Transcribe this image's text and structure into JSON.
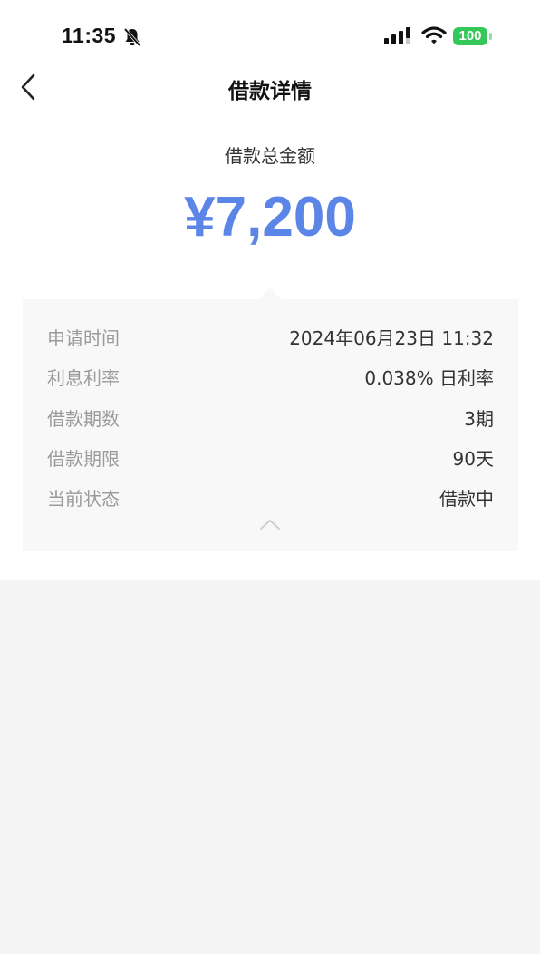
{
  "status_bar": {
    "time": "11:35",
    "battery": "100",
    "icons": [
      "bell-off-icon",
      "signal-icon",
      "wifi-icon",
      "battery-icon"
    ]
  },
  "nav": {
    "back_icon": "chevron-left-icon",
    "title": "借款详情"
  },
  "loan": {
    "total_label": "借款总金额",
    "total_amount": "¥7,200"
  },
  "details": {
    "rows": [
      {
        "label": "申请时间",
        "value": "2024年06月23日 11:32"
      },
      {
        "label": "利息利率",
        "value": "0.038% 日利率"
      },
      {
        "label": "借款期数",
        "value": "3期"
      },
      {
        "label": "借款期限",
        "value": "90天"
      },
      {
        "label": "当前状态",
        "value": "借款中"
      }
    ],
    "collapse_icon": "chevron-up-icon"
  },
  "colors": {
    "amount": "#5b85e6",
    "battery": "#35c759",
    "background": "#f4f4f4"
  }
}
